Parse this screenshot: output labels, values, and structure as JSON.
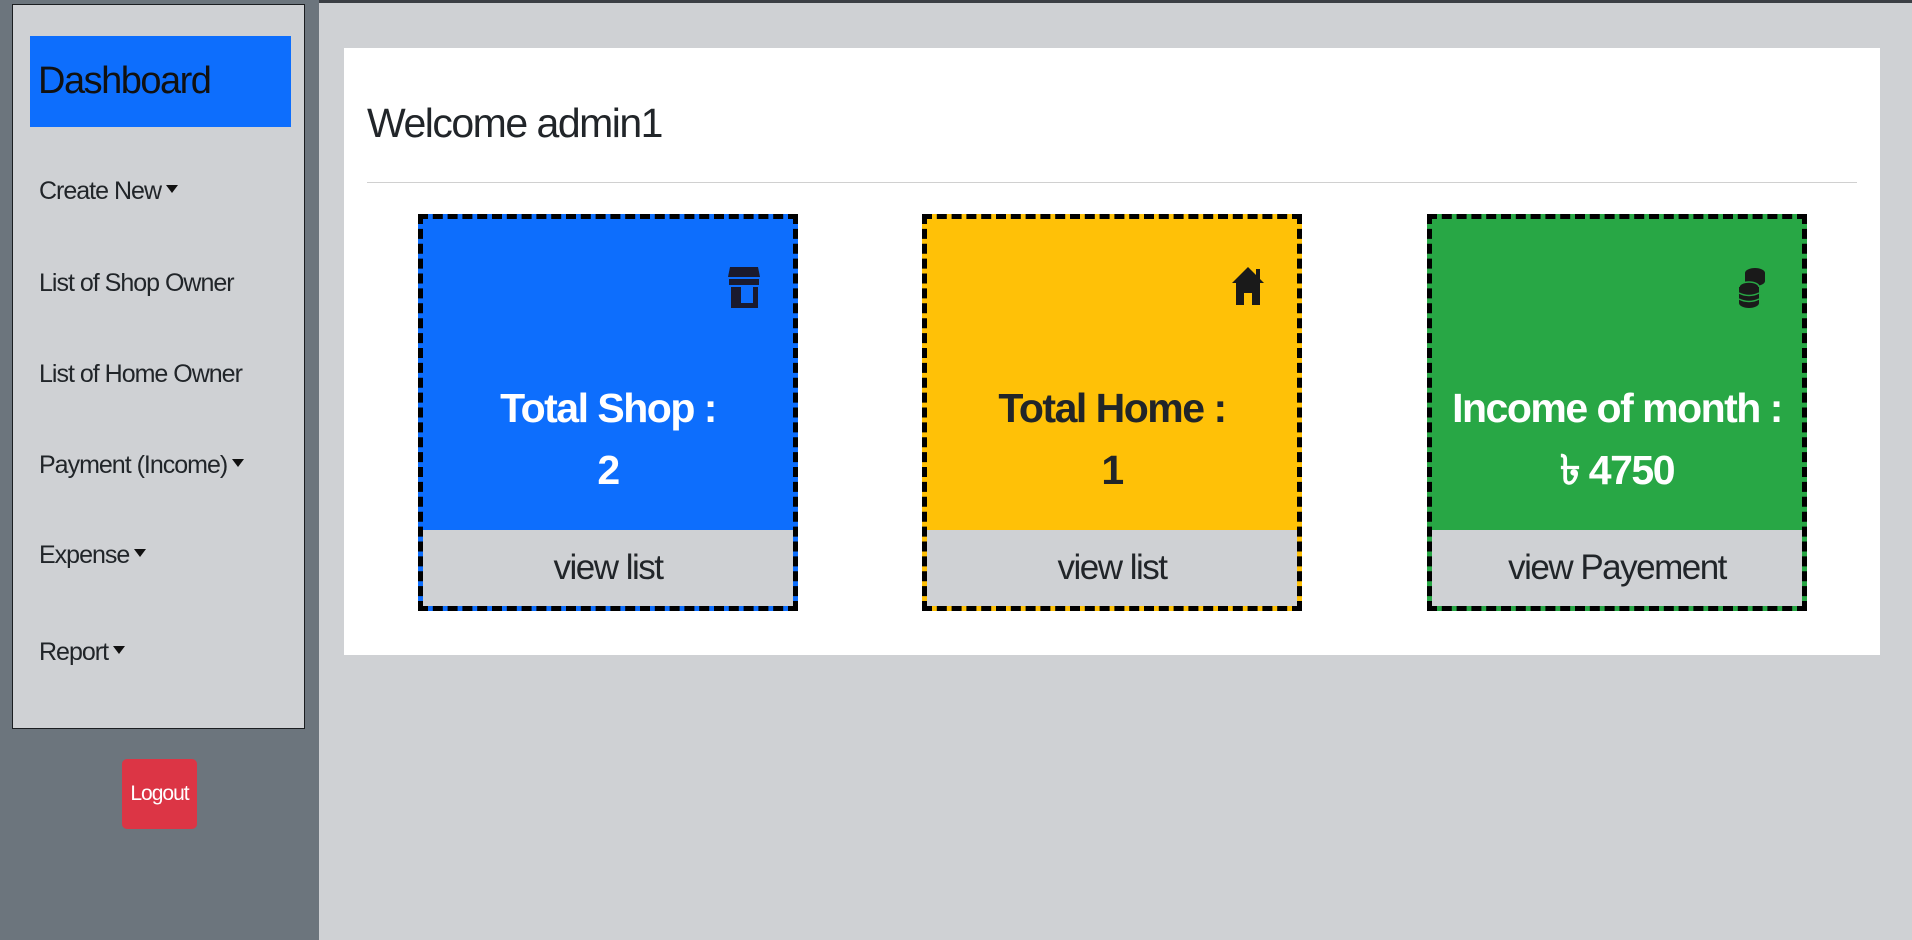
{
  "sidebar": {
    "brand": "Dashboard",
    "items": [
      {
        "label": "Create New",
        "caret": true
      },
      {
        "label": "List of Shop Owner",
        "caret": false
      },
      {
        "label": "List of Home Owner",
        "caret": false
      },
      {
        "label": "Payment (Income)",
        "caret": true
      },
      {
        "label": "Expense",
        "caret": true
      },
      {
        "label": "Report",
        "caret": true
      }
    ],
    "logout_label": "Logout"
  },
  "main": {
    "welcome": "Welcome admin1",
    "cards": [
      {
        "title": "Total Shop :",
        "value": "2",
        "footer": "view list",
        "icon": "store-icon",
        "color": "#0d6efd"
      },
      {
        "title": "Total Home :",
        "value": "1",
        "footer": "view list",
        "icon": "home-icon",
        "color": "#ffc107"
      },
      {
        "title": "Income of month :",
        "value": "৳ 4750",
        "footer": "view Payement",
        "icon": "coins-icon",
        "color": "#28a745"
      }
    ]
  },
  "colors": {
    "primary": "#0d6efd",
    "warning": "#ffc107",
    "success": "#28a745",
    "danger": "#dc3545",
    "sidebar": "#6c757d",
    "page_bg": "#cfd1d4"
  }
}
